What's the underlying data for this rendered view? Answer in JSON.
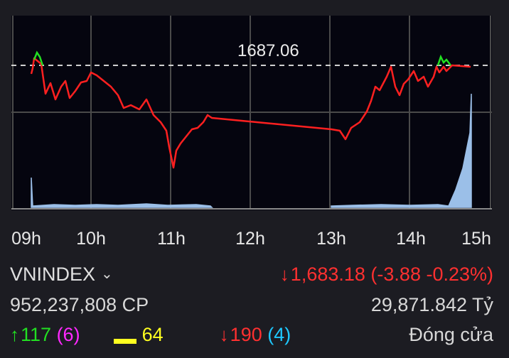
{
  "chart": {
    "reference_label": "1687.06",
    "time_axis": [
      "09h",
      "10h",
      "11h",
      "12h",
      "13h",
      "14h",
      "15h"
    ]
  },
  "index": {
    "name": "VNINDEX",
    "price": "1,683.18",
    "change": "(-3.88 -0.23%)",
    "volume": "952,237,808 CP",
    "value": "29,871.842 Tỷ"
  },
  "breadth": {
    "up": "117",
    "ceiling": "(6)",
    "unchanged": "64",
    "down": "190",
    "floor": "(4)",
    "status": "Đóng cửa"
  },
  "colors": {
    "up": "#22e022",
    "down": "#ff3030",
    "ceiling": "#ff28ff",
    "floor": "#1ec8ff",
    "unchanged": "#ffff20",
    "volume_fill": "#9bbfe8"
  },
  "icons": {
    "up": "arrow-up-icon",
    "down": "arrow-down-icon",
    "dropdown": "chevron-down-icon"
  }
}
